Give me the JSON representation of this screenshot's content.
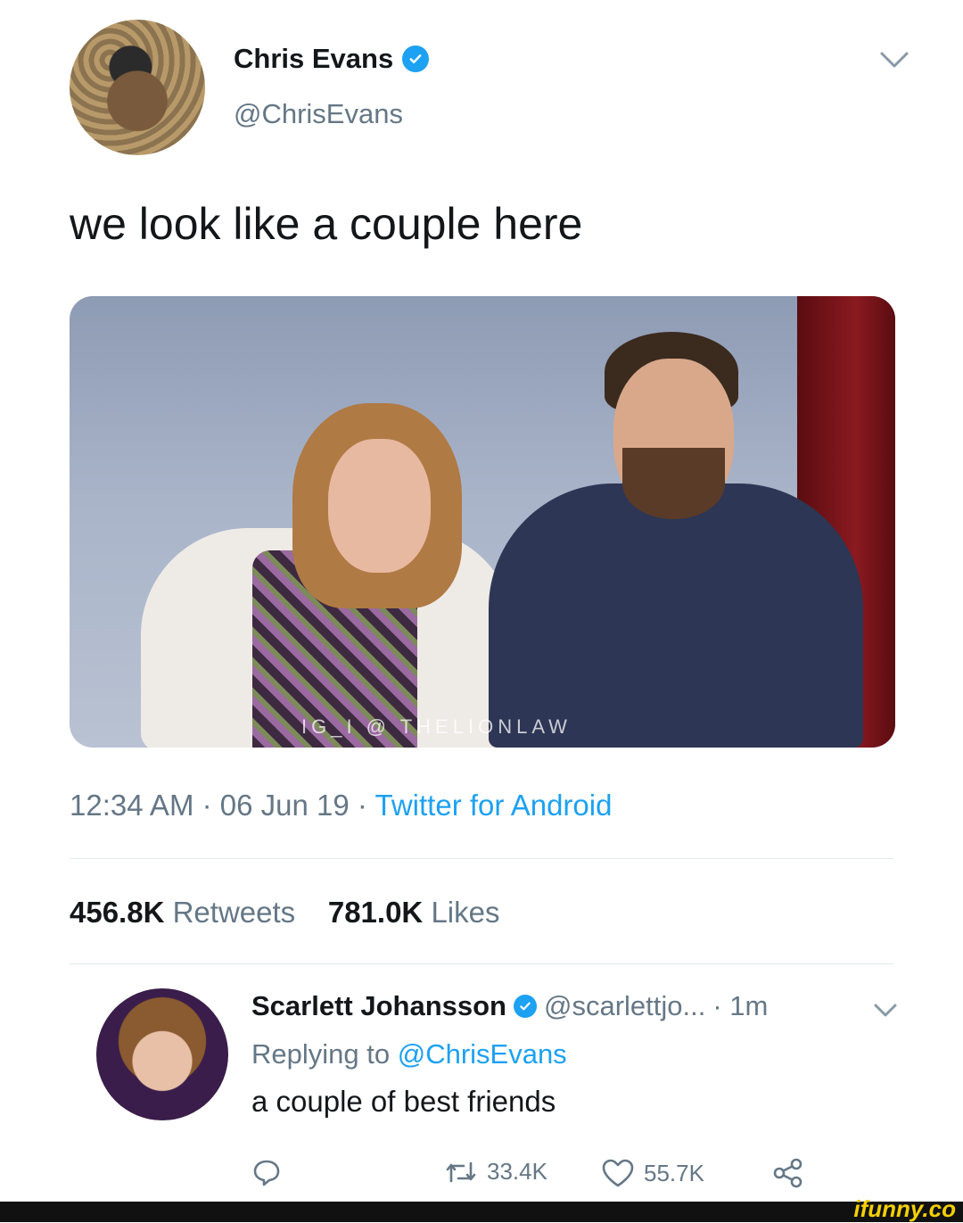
{
  "tweet": {
    "author_name": "Chris Evans",
    "author_handle": "@ChrisEvans",
    "text": "we look like a couple here",
    "photo_watermark": "IG_I @ THELIONLAW",
    "time": "12:34 AM",
    "date": "06 Jun 19",
    "source": "Twitter for Android",
    "separator": "·",
    "retweets_count": "456.8K",
    "retweets_label": "Retweets",
    "likes_count": "781.0K",
    "likes_label": "Likes"
  },
  "reply": {
    "author_name": "Scarlett Johansson",
    "author_handle": "@scarlettjo...",
    "age": "· 1m",
    "replying_label": "Replying to",
    "replying_to": "@ChrisEvans",
    "text": "a couple of best friends",
    "retweet_count": "33.4K",
    "like_count": "55.7K"
  },
  "watermark": "ifunny.co",
  "colors": {
    "accent": "#1da1f2",
    "secondary_text": "#657786",
    "primary_text": "#14171a",
    "divider": "#e1e8ed"
  },
  "icons": [
    "verified-badge-icon",
    "chevron-down-icon",
    "reply-icon",
    "retweet-icon",
    "like-icon",
    "share-icon"
  ]
}
